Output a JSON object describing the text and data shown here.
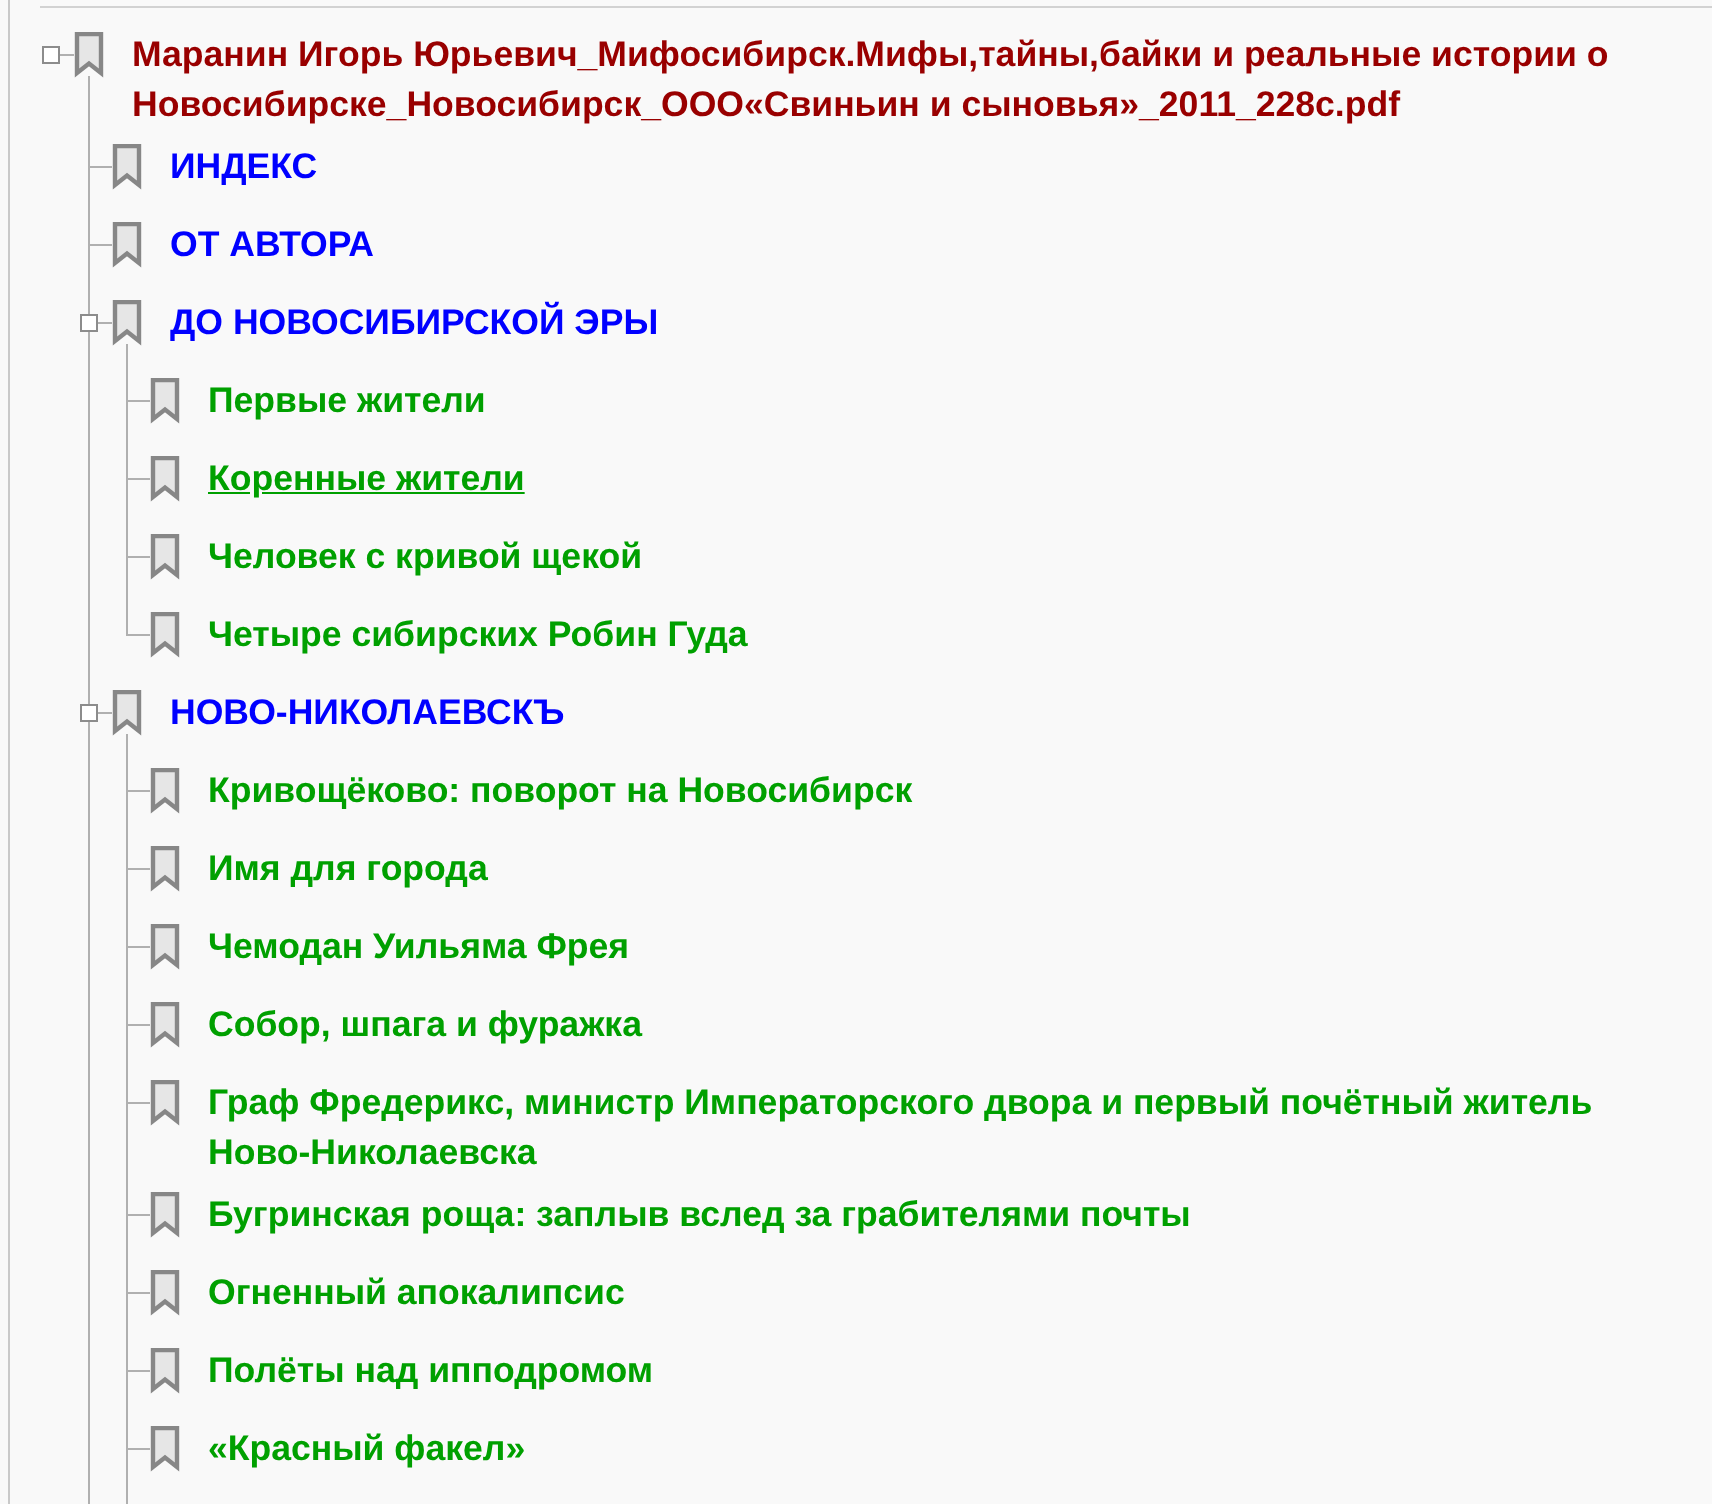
{
  "bookmarks": [
    {
      "title": "Маранин Игорь Юрьевич_Мифосибирск.Мифы,тайны,байки и реальные истории о Новосибирске_Новосибирск_ООО«Свиньин и сыновья»_2011_228с.pdf",
      "color": "#990000",
      "hovered": false,
      "expanded": true,
      "more_below": true,
      "children": [
        {
          "title": "ИНДЕКС",
          "color": "#0000ff",
          "hovered": false
        },
        {
          "title": "ОТ АВТОРА",
          "color": "#0000ff",
          "hovered": false
        },
        {
          "title": "ДО НОВОСИБИРСКОЙ ЭРЫ",
          "color": "#0000ff",
          "hovered": false,
          "expanded": true,
          "more_below": false,
          "children": [
            {
              "title": "Первые жители",
              "color": "#00a000",
              "hovered": false
            },
            {
              "title": "Коренные жители",
              "color": "#00a000",
              "hovered": true
            },
            {
              "title": "Человек с кривой щекой",
              "color": "#00a000",
              "hovered": false
            },
            {
              "title": "Четыре сибирских Робин Гуда",
              "color": "#00a000",
              "hovered": false
            }
          ]
        },
        {
          "title": "НОВО-НИКОЛАЕВСКЪ",
          "color": "#0000ff",
          "hovered": false,
          "expanded": true,
          "more_below": true,
          "children": [
            {
              "title": "Кривощёково: поворот на Новосибирск",
              "color": "#00a000",
              "hovered": false
            },
            {
              "title": "Имя для города",
              "color": "#00a000",
              "hovered": false
            },
            {
              "title": "Чемодан Уильяма Фрея",
              "color": "#00a000",
              "hovered": false
            },
            {
              "title": "Собор, шпага и фуражка",
              "color": "#00a000",
              "hovered": false
            },
            {
              "title": "Граф Фредерикс, министр Императорского двора и первый почётный житель Ново-Николаевска",
              "color": "#00a000",
              "hovered": false
            },
            {
              "title": "Бугринская роща: заплыв вслед за грабителями почты",
              "color": "#00a000",
              "hovered": false
            },
            {
              "title": "Огненный апокалипсис",
              "color": "#00a000",
              "hovered": false
            },
            {
              "title": "Полёты над ипподромом",
              "color": "#00a000",
              "hovered": false
            },
            {
              "title": "«Красный факел»",
              "color": "#00a000",
              "hovered": false
            }
          ]
        }
      ]
    }
  ]
}
